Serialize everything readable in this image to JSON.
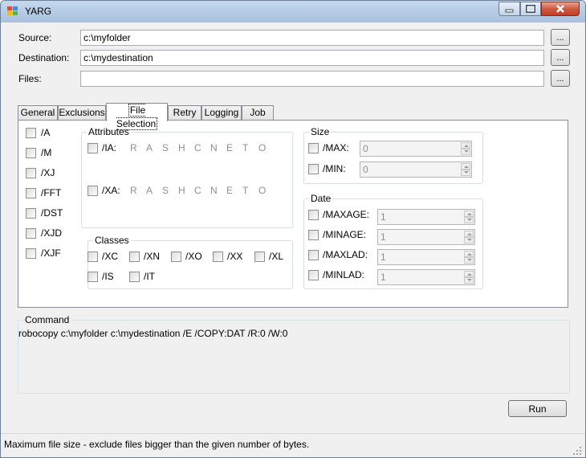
{
  "window": {
    "title": "YARG"
  },
  "paths": {
    "source_label": "Source:",
    "source_value": "c:\\myfolder",
    "destination_label": "Destination:",
    "destination_value": "c:\\mydestination",
    "files_label": "Files:",
    "files_value": "",
    "browse_label": "..."
  },
  "tabs": [
    {
      "label": "General"
    },
    {
      "label": "Exclusions"
    },
    {
      "label": "File Selection"
    },
    {
      "label": "Retry"
    },
    {
      "label": "Logging"
    },
    {
      "label": "Job"
    }
  ],
  "active_tab": "File Selection",
  "options": [
    "/A",
    "/M",
    "/XJ",
    "/FFT",
    "/DST",
    "/XJD",
    "/XJF"
  ],
  "attributes": {
    "title": "Attributes",
    "ia_label": "/IA:",
    "xa_label": "/XA:",
    "letters": [
      "R",
      "A",
      "S",
      "H",
      "C",
      "N",
      "E",
      "T",
      "O"
    ]
  },
  "classes": {
    "title": "Classes",
    "items": [
      "/XC",
      "/XN",
      "/XO",
      "/XX",
      "/XL",
      "/IS",
      "/IT"
    ]
  },
  "size": {
    "title": "Size",
    "max_label": "/MAX:",
    "max_value": "0",
    "min_label": "/MIN:",
    "min_value": "0"
  },
  "date": {
    "title": "Date",
    "maxage_label": "/MAXAGE:",
    "maxage_value": "1",
    "minage_label": "/MINAGE:",
    "minage_value": "1",
    "maxlad_label": "/MAXLAD:",
    "maxlad_value": "1",
    "minlad_label": "/MINLAD:",
    "minlad_value": "1"
  },
  "command": {
    "title": "Command",
    "text": "robocopy c:\\myfolder c:\\mydestination /E /COPY:DAT /R:0 /W:0"
  },
  "run_label": "Run",
  "status_text": "Maximum file size - exclude files bigger than the given number of bytes."
}
